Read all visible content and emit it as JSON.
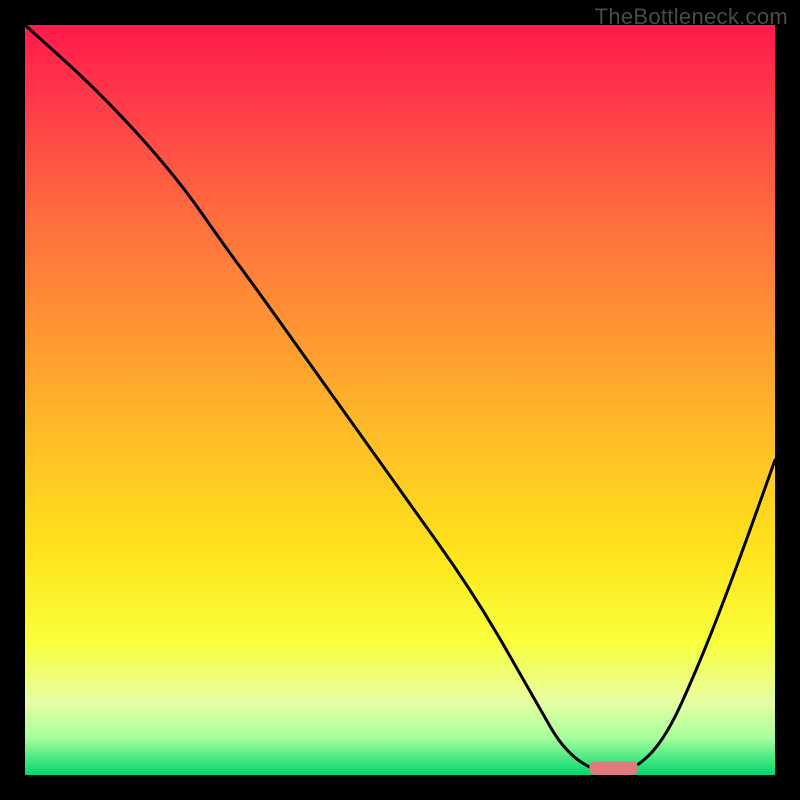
{
  "watermark": "TheBottleneck.com",
  "chart_data": {
    "type": "line",
    "title": "",
    "xlabel": "",
    "ylabel": "",
    "xlim": [
      0,
      100
    ],
    "ylim": [
      0,
      100
    ],
    "series": [
      {
        "name": "curve",
        "x": [
          0,
          10,
          20,
          27,
          30,
          40,
          50,
          60,
          68,
          72,
          77,
          80,
          85,
          90,
          95,
          100
        ],
        "y": [
          100,
          91,
          80,
          70,
          66,
          52,
          38,
          24,
          10,
          3,
          0,
          0,
          4,
          15,
          28,
          42
        ]
      }
    ],
    "marker": {
      "x": 78.5,
      "y": 0,
      "color": "#e07a7d",
      "width": 6.5,
      "height": 2
    },
    "gradient_stops": [
      {
        "offset": 0.0,
        "color": "#ff1a4b"
      },
      {
        "offset": 0.1,
        "color": "#ff3a4a"
      },
      {
        "offset": 0.25,
        "color": "#ff6b3f"
      },
      {
        "offset": 0.4,
        "color": "#ff9433"
      },
      {
        "offset": 0.55,
        "color": "#ffbd27"
      },
      {
        "offset": 0.7,
        "color": "#ffe31b"
      },
      {
        "offset": 0.82,
        "color": "#f8ff3a"
      },
      {
        "offset": 0.9,
        "color": "#e8ffa0"
      },
      {
        "offset": 0.95,
        "color": "#a8ff9e"
      },
      {
        "offset": 1.0,
        "color": "#00d66b"
      }
    ]
  }
}
